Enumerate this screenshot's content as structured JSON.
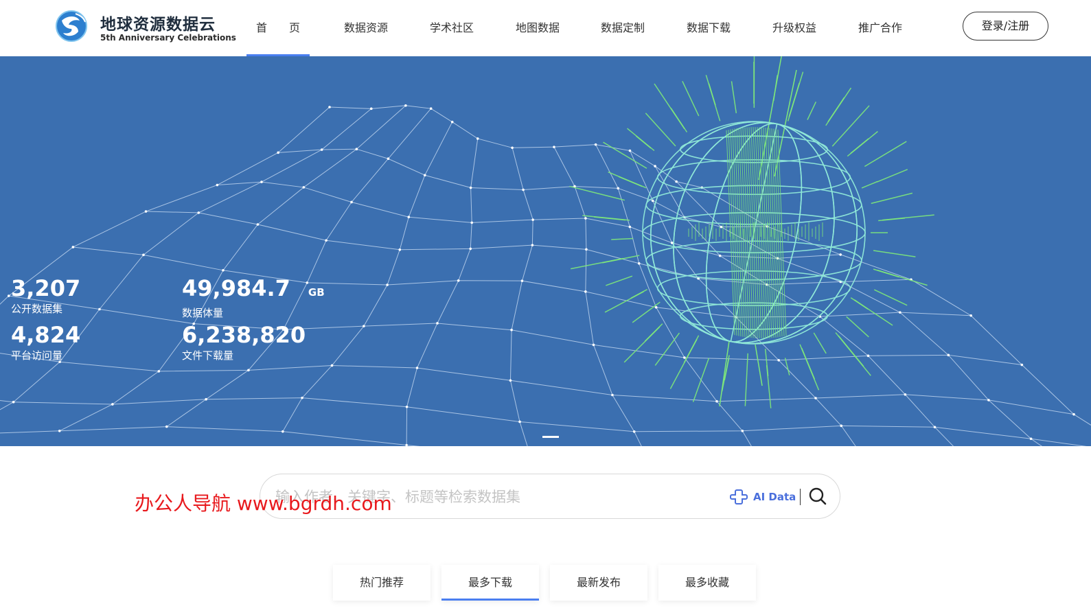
{
  "brand": {
    "title": "地球资源数据云",
    "subtitle": "5th Anniversary Celebrations"
  },
  "nav": {
    "items": [
      {
        "label": "首　　页",
        "active": true
      },
      {
        "label": "数据资源"
      },
      {
        "label": "学术社区"
      },
      {
        "label": "地图数据"
      },
      {
        "label": "数据定制"
      },
      {
        "label": "数据下载"
      },
      {
        "label": "升级权益"
      },
      {
        "label": "推广合作"
      }
    ],
    "login_label": "登录/注册"
  },
  "banner": {
    "stats": [
      {
        "value": "3,207",
        "label": "公开数据集"
      },
      {
        "value": "49,984.7",
        "unit": "GB",
        "label": "数据体量"
      },
      {
        "value": "4,824",
        "label": "平台访问量"
      },
      {
        "value": "6,238,820",
        "label": "文件下载量"
      }
    ],
    "colors": {
      "background": "#3b6fb0",
      "grid": "#cfe0f5",
      "globe": "#8fe8d8",
      "rays": "#7ee87a"
    }
  },
  "search": {
    "placeholder": "输入作者、关键字、标题等检索数据集",
    "ai_label": "AI Data"
  },
  "watermark": "办公人导航  www.bgrdh.com",
  "tabs": [
    {
      "label": "热门推荐"
    },
    {
      "label": "最多下载",
      "active": true
    },
    {
      "label": "最新发布"
    },
    {
      "label": "最多收藏"
    }
  ],
  "accent_color": "#4a7ef0"
}
